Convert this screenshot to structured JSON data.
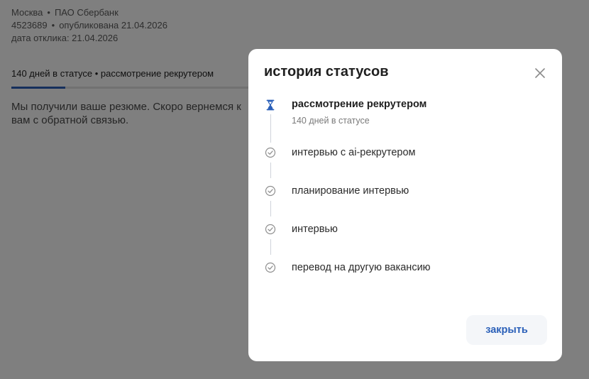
{
  "vacancy": {
    "city": "Москва",
    "company": "ПАО Сбербанк",
    "id": "4523689",
    "published": "опубликована 21.04.2026",
    "response_date": "дата отклика: 21.04.2026",
    "separator": "•"
  },
  "status_bar": {
    "text": "140 дней в статусе • рассмотрение рекрутером",
    "progress": 0.2
  },
  "message": "Мы получили ваше резюме. Скоро вернемся к вам с обратной связью.",
  "modal": {
    "title": "история статусов",
    "steps": [
      {
        "label": "рассмотрение рекрутером",
        "sub": "140 дней в статусе",
        "state": "current"
      },
      {
        "label": "интервью с ai-рекрутером",
        "state": "done"
      },
      {
        "label": "планирование интервью",
        "state": "done"
      },
      {
        "label": "интервью",
        "state": "done"
      },
      {
        "label": "перевод на другую вакансию",
        "state": "done"
      }
    ],
    "close_button": "закрыть"
  },
  "colors": {
    "accent": "#2a5fb8",
    "overlay": "#00000080",
    "connector": "#cfd3da"
  }
}
